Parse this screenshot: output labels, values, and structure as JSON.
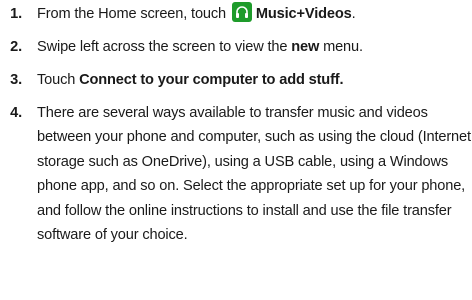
{
  "steps": [
    {
      "number": "1",
      "text_before": "From the Home screen, touch ",
      "icon": "headphones-icon",
      "icon_color": "#1e9b2b",
      "bold": "Music+Videos",
      "text_after": "."
    },
    {
      "number": "2",
      "text_before": "Swipe left across the screen to view the ",
      "bold": "new",
      "text_after": " menu."
    },
    {
      "number": "3",
      "text_before": "Touch ",
      "bold": "Connect to your computer to add stuff.",
      "text_after": ""
    },
    {
      "number": "4",
      "text": "There are several ways available to transfer music and videos between your phone and computer, such as using the cloud (Internet storage such as OneDrive), using a USB cable, using a Windows phone app, and so on. Select the appropriate set up for your phone, and follow the online instructions to install and use the file transfer software of your choice."
    }
  ]
}
